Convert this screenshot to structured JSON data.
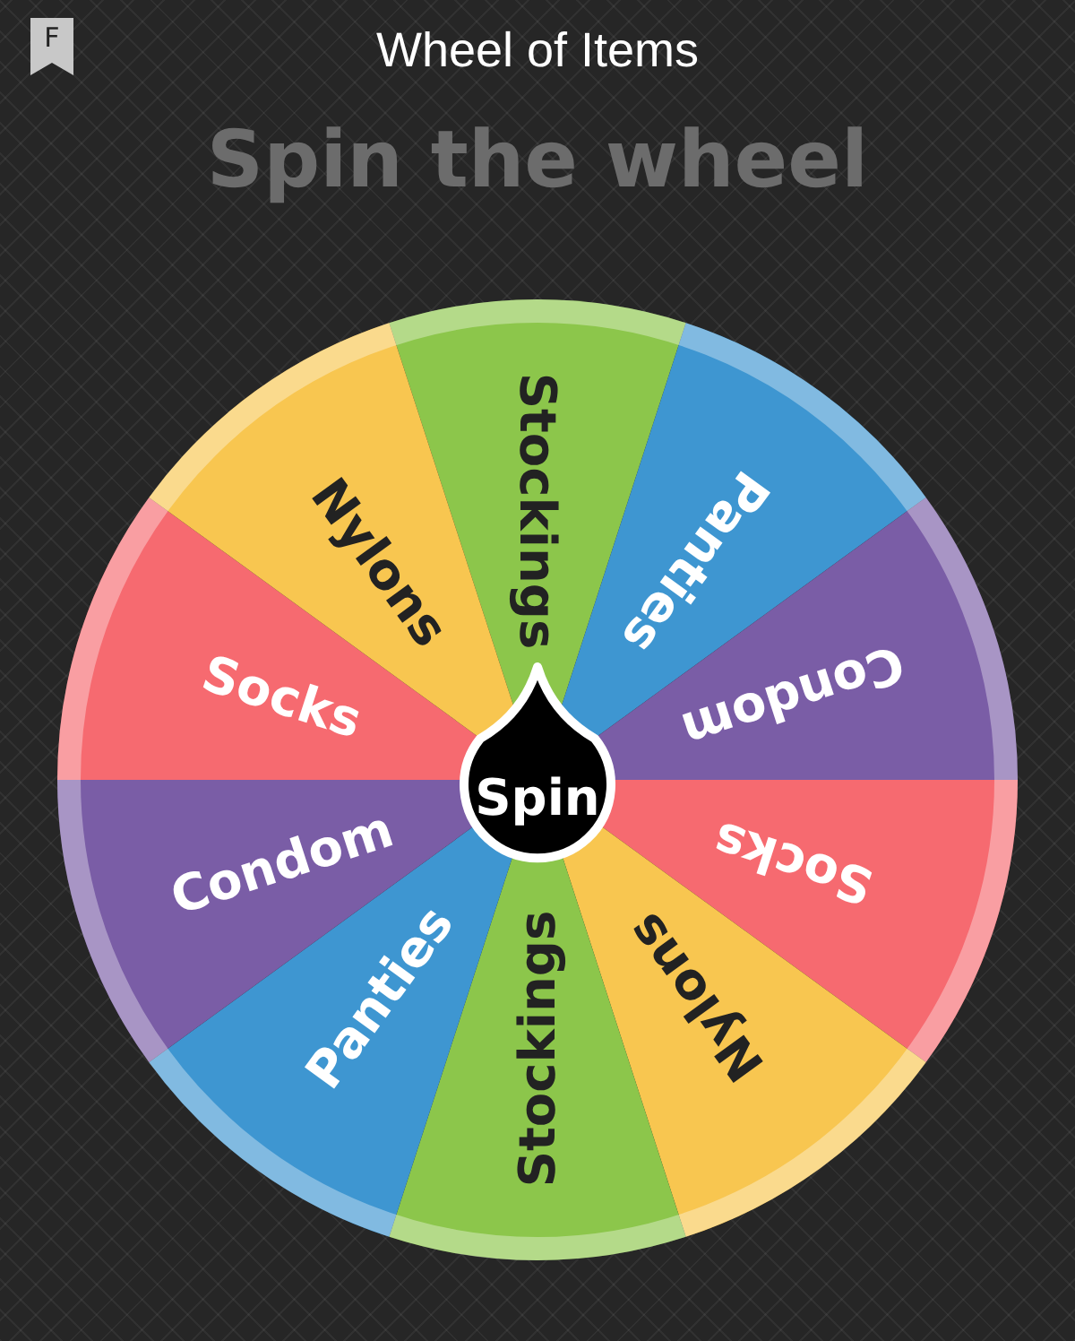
{
  "app_bar": {
    "logo_letter": "F",
    "title": "Wheel of Items"
  },
  "heading": "Spin the wheel",
  "wheel": {
    "segments": [
      {
        "label": "Stockings",
        "color": "#8cc64b"
      },
      {
        "label": "Panties",
        "color": "#3e96d1"
      },
      {
        "label": "Condom",
        "color": "#7a5da6"
      },
      {
        "label": "Socks",
        "color": "#f66a70"
      },
      {
        "label": "Nylons",
        "color": "#f8c650"
      },
      {
        "label": "Stockings",
        "color": "#8cc64b"
      },
      {
        "label": "Panties",
        "color": "#3e96d1"
      },
      {
        "label": "Condom",
        "color": "#7a5da6"
      },
      {
        "label": "Socks",
        "color": "#f66a70"
      },
      {
        "label": "Nylons",
        "color": "#f8c650"
      }
    ],
    "spin_button": "Spin"
  }
}
